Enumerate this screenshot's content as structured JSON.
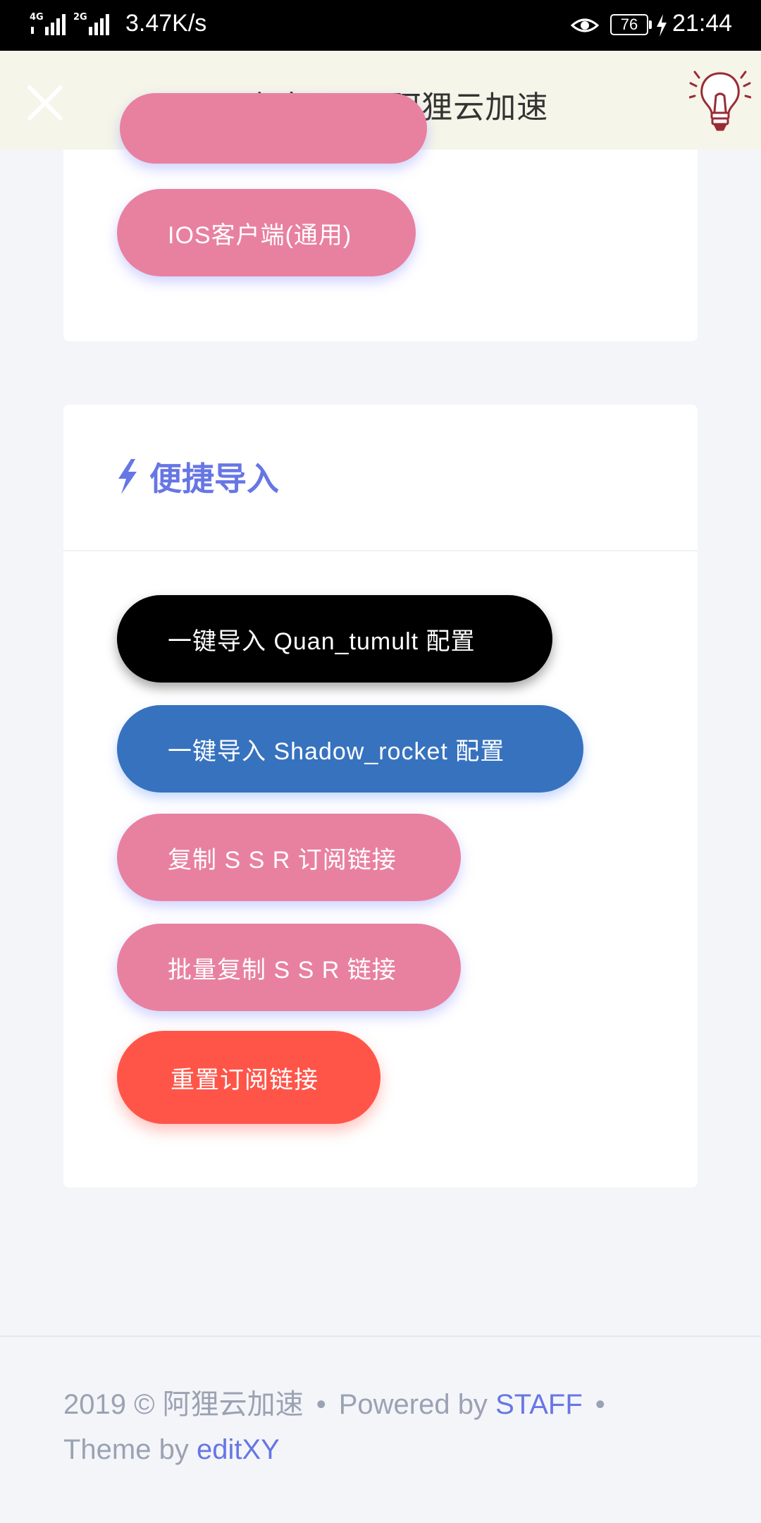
{
  "status_bar": {
    "network_1": "4G",
    "network_2": "2G",
    "speed": "3.47K/s",
    "battery": "76",
    "time": "21:44"
  },
  "header": {
    "title": "用户中心 — 阿狸云加速",
    "close_icon": "close-icon",
    "tip_icon": "lightbulb-icon"
  },
  "clients_card": {
    "buttons": [
      "IOS客户端(通用)"
    ]
  },
  "quick_import": {
    "heading": "便捷导入",
    "heading_icon": "bolt-icon",
    "buttons": [
      {
        "label": "一键导入 Quan_tumult 配置",
        "color": "#000000"
      },
      {
        "label": "一键导入 Shadow_rocket 配置",
        "color": "#3772be"
      },
      {
        "label": "复制 S S R 订阅链接",
        "color": "#e8819f"
      },
      {
        "label": "批量复制 S S R 链接",
        "color": "#e8819f"
      },
      {
        "label": "重置订阅链接",
        "color": "#ff5549"
      }
    ]
  },
  "footer": {
    "year": "2019 © 阿狸云加速",
    "powered_prefix": "Powered by",
    "powered_link": "STAFF",
    "theme_prefix": "Theme by",
    "theme_link": "editXY",
    "separator": "•"
  }
}
